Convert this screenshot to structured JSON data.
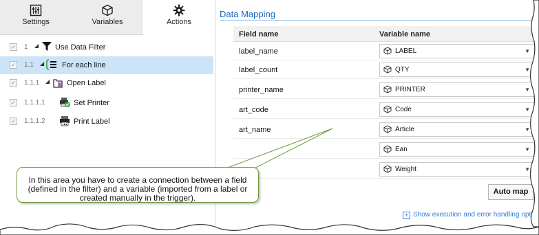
{
  "tabs": [
    {
      "label": "Settings",
      "icon": "settings-icon"
    },
    {
      "label": "Variables",
      "icon": "variables-icon"
    },
    {
      "label": "Actions",
      "icon": "actions-gear-icon"
    }
  ],
  "tree": [
    {
      "number": "1",
      "label": "Use Data Filter",
      "icon": "filter-icon",
      "checked": true
    },
    {
      "number": "1.1",
      "label": "For each line",
      "icon": "for-each-line-icon",
      "checked": true,
      "selected": true
    },
    {
      "number": "1.1.1",
      "label": "Open Label",
      "icon": "open-label-icon",
      "checked": true
    },
    {
      "number": "1.1.1.1",
      "label": "Set Printer",
      "icon": "set-printer-icon",
      "checked": true
    },
    {
      "number": "1.1.1.2",
      "label": "Print Label",
      "icon": "print-label-icon",
      "checked": true
    }
  ],
  "mapping": {
    "title": "Data Mapping",
    "header_field": "Field name",
    "header_variable": "Variable name",
    "rows": [
      {
        "field": "label_name",
        "variable": "LABEL"
      },
      {
        "field": "label_count",
        "variable": "QTY"
      },
      {
        "field": "printer_name",
        "variable": "PRINTER"
      },
      {
        "field": "art_code",
        "variable": "Code"
      },
      {
        "field": "art_name",
        "variable": "Article"
      },
      {
        "field": "",
        "variable": "Ean"
      },
      {
        "field": "",
        "variable": "Weight"
      }
    ],
    "auto_map": "Auto map",
    "show_execution": "Show execution and error handling options"
  },
  "callout": {
    "line1": "In this area you have to create a connection between a field",
    "line2": "(defined in the filter) and a variable (imported from a label or",
    "line3": "created manually in the trigger)."
  },
  "colors": {
    "accent": "#1565c0",
    "selection": "#cce4f7",
    "callout_border": "#6e9a3a",
    "link": "#2e7fd6"
  }
}
